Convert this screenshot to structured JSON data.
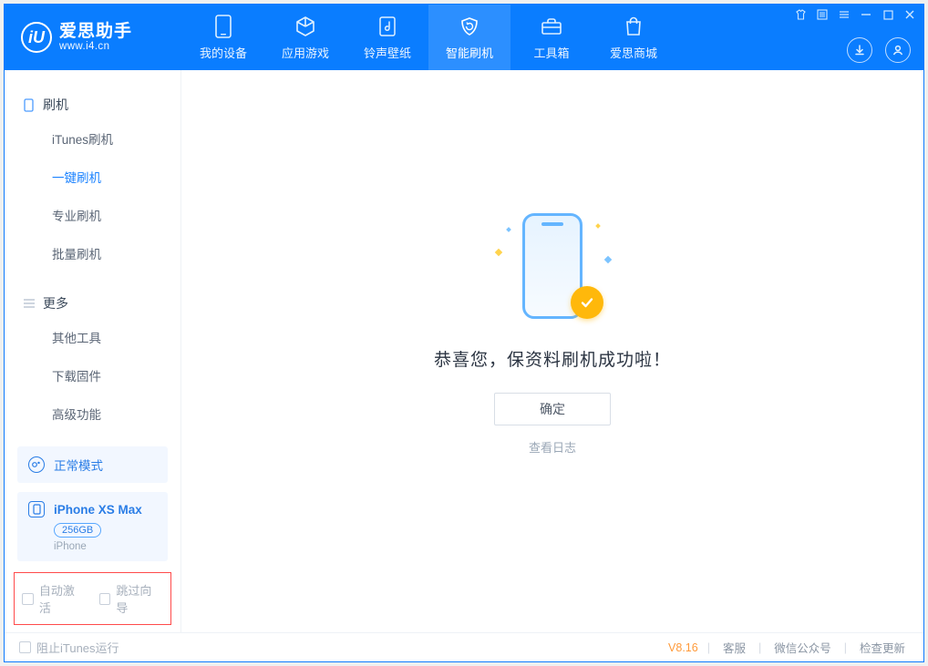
{
  "app": {
    "name_cn": "爱思助手",
    "url": "www.i4.cn",
    "logo_letter": "iU"
  },
  "nav": [
    {
      "label": "我的设备",
      "icon": "device"
    },
    {
      "label": "应用游戏",
      "icon": "cube"
    },
    {
      "label": "铃声壁纸",
      "icon": "music"
    },
    {
      "label": "智能刷机",
      "icon": "refresh"
    },
    {
      "label": "工具箱",
      "icon": "toolbox"
    },
    {
      "label": "爱思商城",
      "icon": "bag"
    }
  ],
  "nav_active_index": 3,
  "sidebar": {
    "section1_title": "刷机",
    "section1_items": [
      "iTunes刷机",
      "一键刷机",
      "专业刷机",
      "批量刷机"
    ],
    "section1_selected": 1,
    "section2_title": "更多",
    "section2_items": [
      "其他工具",
      "下载固件",
      "高级功能"
    ]
  },
  "mode": {
    "label": "正常模式"
  },
  "device": {
    "name": "iPhone XS Max",
    "storage": "256GB",
    "type": "iPhone"
  },
  "checks": {
    "auto_activate": "自动激活",
    "skip_guide": "跳过向导"
  },
  "main": {
    "success_msg": "恭喜您，保资料刷机成功啦！",
    "ok_btn": "确定",
    "view_log": "查看日志"
  },
  "footer": {
    "block_itunes": "阻止iTunes运行",
    "version": "V8.16",
    "links": [
      "客服",
      "微信公众号",
      "检查更新"
    ]
  }
}
